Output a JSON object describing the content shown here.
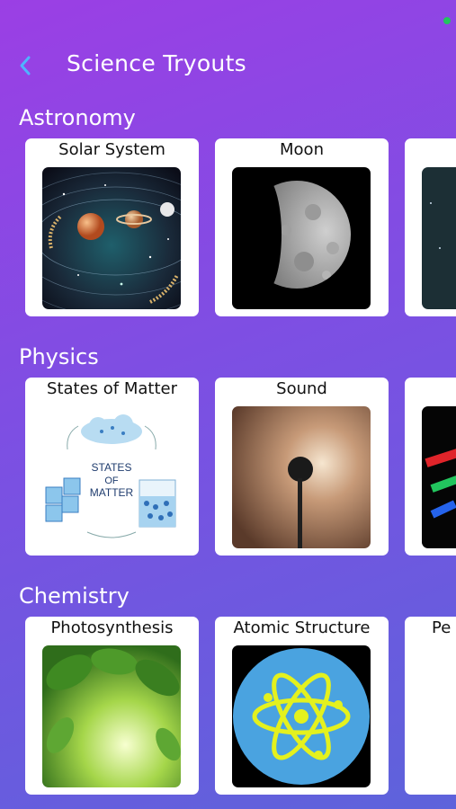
{
  "header": {
    "title": "Science Tryouts"
  },
  "sections": [
    {
      "title": "Astronomy",
      "cards": [
        {
          "label": "Solar System"
        },
        {
          "label": "Moon"
        },
        {
          "label": ""
        }
      ]
    },
    {
      "title": "Physics",
      "cards": [
        {
          "label": "States of Matter"
        },
        {
          "label": "Sound"
        },
        {
          "label": ""
        }
      ]
    },
    {
      "title": "Chemistry",
      "cards": [
        {
          "label": "Photosynthesis"
        },
        {
          "label": "Atomic Structure"
        },
        {
          "label": "Pe"
        }
      ]
    }
  ],
  "illustrations": {
    "states_of_matter": {
      "line1": "STATES",
      "line2": "OF",
      "line3": "MATTER"
    }
  },
  "colors": {
    "accent": "#4fb3ff",
    "status": "#22c55e"
  }
}
